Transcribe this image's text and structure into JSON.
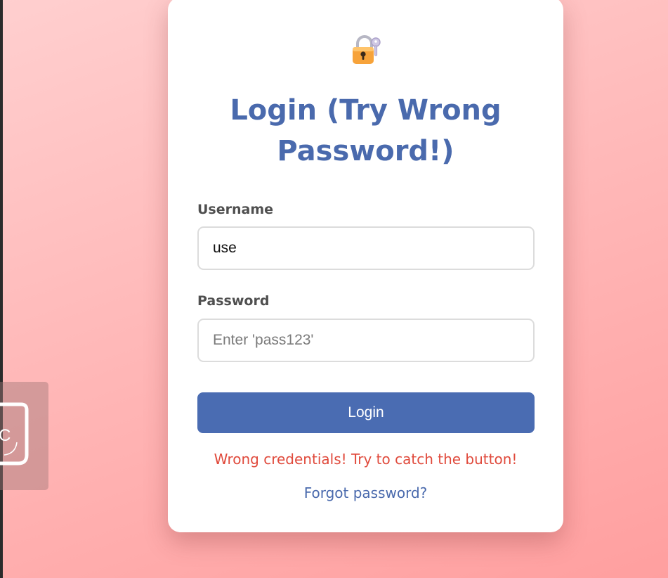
{
  "login": {
    "icon": "locked-with-key-icon",
    "title": "Login (Try Wrong Password!)",
    "username": {
      "label": "Username",
      "value": "use"
    },
    "password": {
      "label": "Password",
      "placeholder": "Enter 'pass123'",
      "value": ""
    },
    "submit_label": "Login",
    "error_message": "Wrong credentials! Try to catch the button!",
    "forgot_link": "Forgot password?"
  },
  "side_widget": {
    "icon": "badge-icon",
    "text": "C"
  },
  "colors": {
    "accent": "#4a6cb2",
    "title": "#4a6aad",
    "error": "#e04a3c"
  }
}
